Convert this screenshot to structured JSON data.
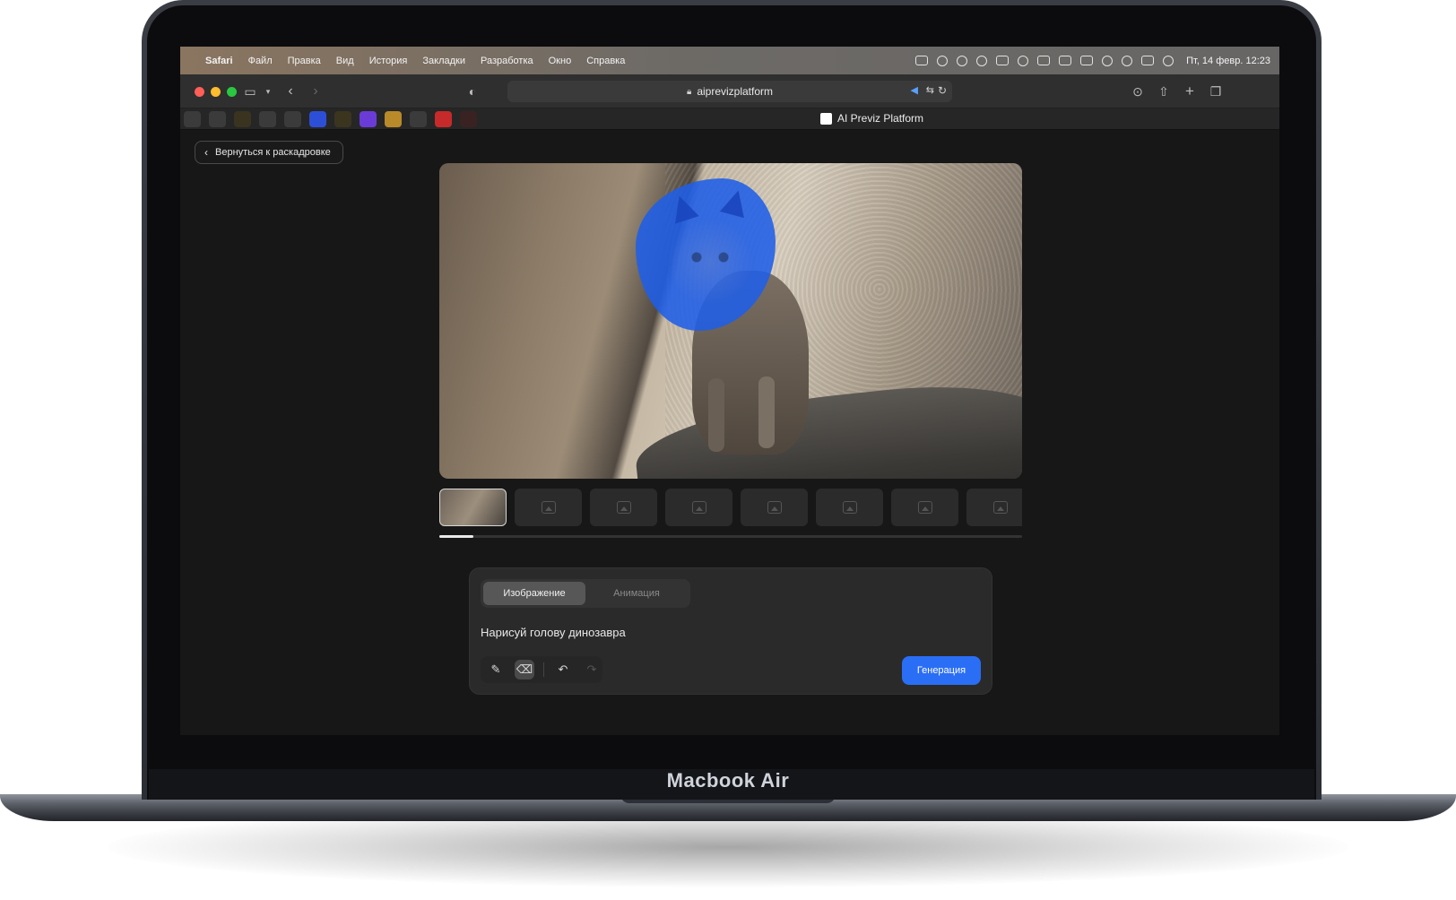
{
  "device": {
    "label": "Macbook Air"
  },
  "menubar": {
    "app": "Safari",
    "items": [
      "Файл",
      "Правка",
      "Вид",
      "История",
      "Закладки",
      "Разработка",
      "Окно",
      "Справка"
    ],
    "clock": "Пт, 14 февр.  12:23"
  },
  "browser": {
    "url": "aiprevizplatform",
    "tab_title": "AI Previz Platform"
  },
  "page": {
    "back_label": "Вернуться к раскадровке",
    "thumbnails_count": 8,
    "active_thumbnail": 1,
    "progress_fraction": 0.058,
    "tabs": [
      {
        "label": "Изображение",
        "active": true
      },
      {
        "label": "Анимация",
        "active": false
      }
    ],
    "prompt": "Нарисуй голову динозавра",
    "generate_label": "Генерация"
  },
  "colors": {
    "accent": "#2a6ef5",
    "mask": "#1f5fe8"
  }
}
